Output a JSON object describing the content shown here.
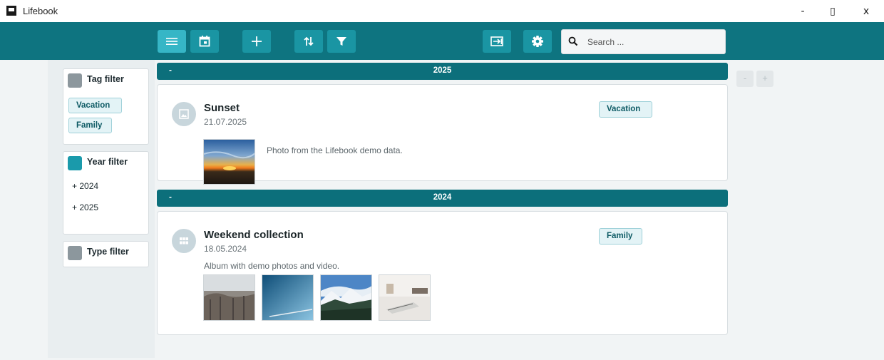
{
  "window": {
    "title": "Lifebook",
    "minimize": "-",
    "maximize": "▯",
    "close": "x"
  },
  "search": {
    "placeholder": "Search ..."
  },
  "filters": {
    "tag": {
      "title": "Tag filter",
      "swatch_color": "#8c979d",
      "chips": [
        "Vacation",
        "Family"
      ]
    },
    "year": {
      "title": "Year filter",
      "swatch_color": "#1a9aab",
      "items": [
        "+ 2024",
        "+ 2025"
      ]
    },
    "type": {
      "title": "Type filter",
      "swatch_color": "#8c979d"
    }
  },
  "groups": [
    {
      "collapse": "-",
      "year": "2025",
      "entries": [
        {
          "title": "Sunset",
          "date": "21.07.2025",
          "tag": "Vacation",
          "description": "Photo from the Lifebook demo data.",
          "icon": "image-icon"
        }
      ]
    },
    {
      "collapse": "-",
      "year": "2024",
      "entries": [
        {
          "title": "Weekend collection",
          "date": "18.05.2024",
          "tag": "Family",
          "description": "Album with demo photos and video.",
          "icon": "grid-icon"
        }
      ]
    }
  ],
  "side_controls": {
    "minus": "-",
    "plus": "+"
  },
  "colors": {
    "toolbar": "#0e7480",
    "button": "#1a95a3",
    "button_active": "#36b6c6",
    "group_bar": "#0c6f7b"
  }
}
